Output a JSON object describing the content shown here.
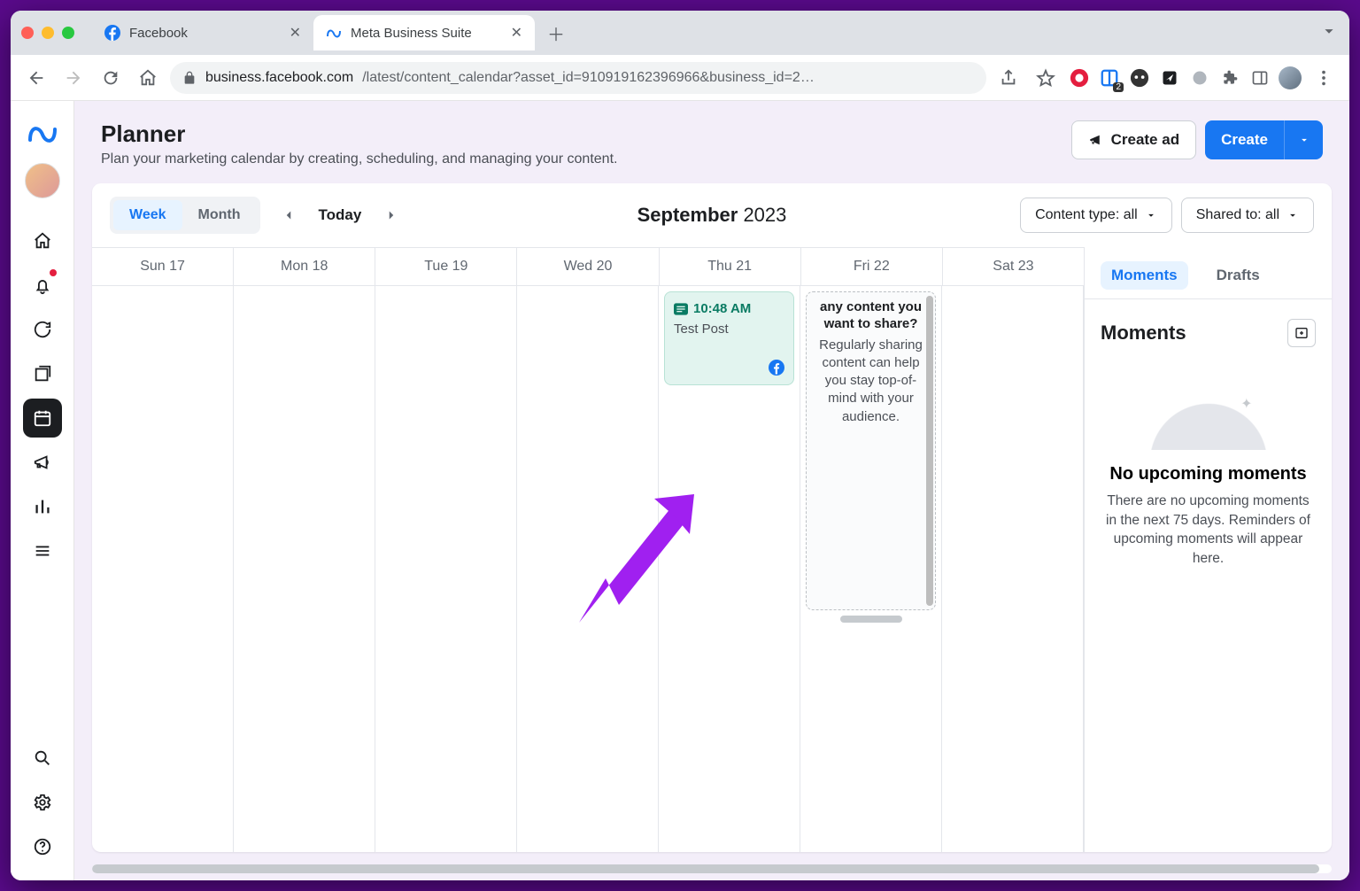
{
  "browser": {
    "tabs": [
      {
        "title": "Facebook",
        "favicon": "facebook"
      },
      {
        "title": "Meta Business Suite",
        "favicon": "meta"
      }
    ],
    "url_host": "business.facebook.com",
    "url_path": "/latest/content_calendar?asset_id=910919162396966&business_id=2…"
  },
  "header": {
    "title": "Planner",
    "subtitle": "Plan your marketing calendar by creating, scheduling, and managing your content.",
    "create_ad": "Create ad",
    "create": "Create"
  },
  "toolbar": {
    "week": "Week",
    "month": "Month",
    "today": "Today",
    "month_name": "September",
    "year": "2023",
    "content_type": "Content type: all",
    "shared_to": "Shared to: all"
  },
  "days": [
    "Sun 17",
    "Mon 18",
    "Tue 19",
    "Wed 20",
    "Thu 21",
    "Fri 22",
    "Sat 23"
  ],
  "post": {
    "time": "10:48 AM",
    "title": "Test Post"
  },
  "hint": {
    "title": "any content you want to share?",
    "body": "Regularly sharing content can help you stay top-of-mind with your audience."
  },
  "side": {
    "tab_moments": "Moments",
    "tab_drafts": "Drafts",
    "heading": "Moments",
    "empty_title": "No upcoming moments",
    "empty_body": "There are no upcoming moments in the next 75 days. Reminders of upcoming moments will appear here."
  }
}
